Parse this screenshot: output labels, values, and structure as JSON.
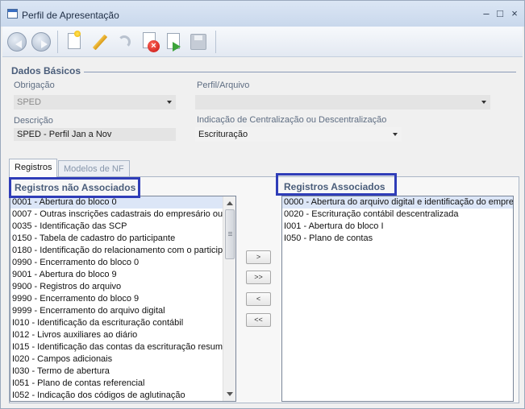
{
  "window": {
    "title": "Perfil de Apresentação",
    "controls": {
      "minimize": "–",
      "maximize": "□",
      "close": "×"
    }
  },
  "toolbar": {
    "buttons": [
      {
        "icon": "back-arrow-icon",
        "enabled": false
      },
      {
        "icon": "forward-arrow-icon",
        "enabled": false
      },
      {
        "icon": "new-document-icon",
        "enabled": true
      },
      {
        "icon": "pencil-edit-icon",
        "enabled": true
      },
      {
        "icon": "undo-icon",
        "enabled": false
      },
      {
        "icon": "delete-icon",
        "enabled": true
      },
      {
        "icon": "export-icon",
        "enabled": true
      },
      {
        "icon": "save-icon",
        "enabled": false
      }
    ]
  },
  "basic_data": {
    "section_title": "Dados Básicos",
    "obrigacao": {
      "label": "Obrigação",
      "value": "SPED"
    },
    "perfil_arquivo": {
      "label": "Perfil/Arquivo",
      "value": ""
    },
    "descricao": {
      "label": "Descrição",
      "value": "SPED - Perfil Jan a Nov"
    },
    "indicacao": {
      "label": "Indicação de Centralização ou Descentralização",
      "value": "Escrituração"
    }
  },
  "tabs": [
    {
      "label": "Registros",
      "active": true
    },
    {
      "label": "Modelos de NF",
      "active": false
    }
  ],
  "registros": {
    "nao_associados": {
      "title": "Registros não Associados",
      "items": [
        "0001 - Abertura do bloco 0",
        "0007 - Outras inscrições cadastrais do empresário ou",
        "0035 - Identificação das SCP",
        "0150 - Tabela de cadastro do participante",
        "0180 - Identificação do relacionamento com o particip",
        "0990 - Encerramento do bloco 0",
        "9001 - Abertura do bloco 9",
        "9900 - Registros do arquivo",
        "9990 - Encerramento do bloco 9",
        "9999 - Encerramento do arquivo digital",
        "I010 - Identificação da escrituração contábil",
        "I012 - Livros auxiliares ao diário",
        "I015 - Identificação das contas da escrituração resum",
        "I020 - Campos adicionais",
        "I030 - Termo de abertura",
        "I051 - Plano de contas referencial",
        "I052 - Indicação dos códigos de aglutinação"
      ],
      "selected_index": 0
    },
    "associados": {
      "title": "Registros Associados",
      "items": [
        "0000 - Abertura do arquivo digital e identificação do empre",
        "0020 - Escrituração contábil descentralizada",
        "I001 - Abertura do bloco I",
        "I050 - Plano de contas"
      ],
      "selected_index": 0
    },
    "move_buttons": [
      ">",
      ">>",
      "<",
      "<<"
    ]
  },
  "colors": {
    "highlight_box": "#2f3db8",
    "selection": "#dce6f7",
    "section_title": "#4a5d7a"
  }
}
